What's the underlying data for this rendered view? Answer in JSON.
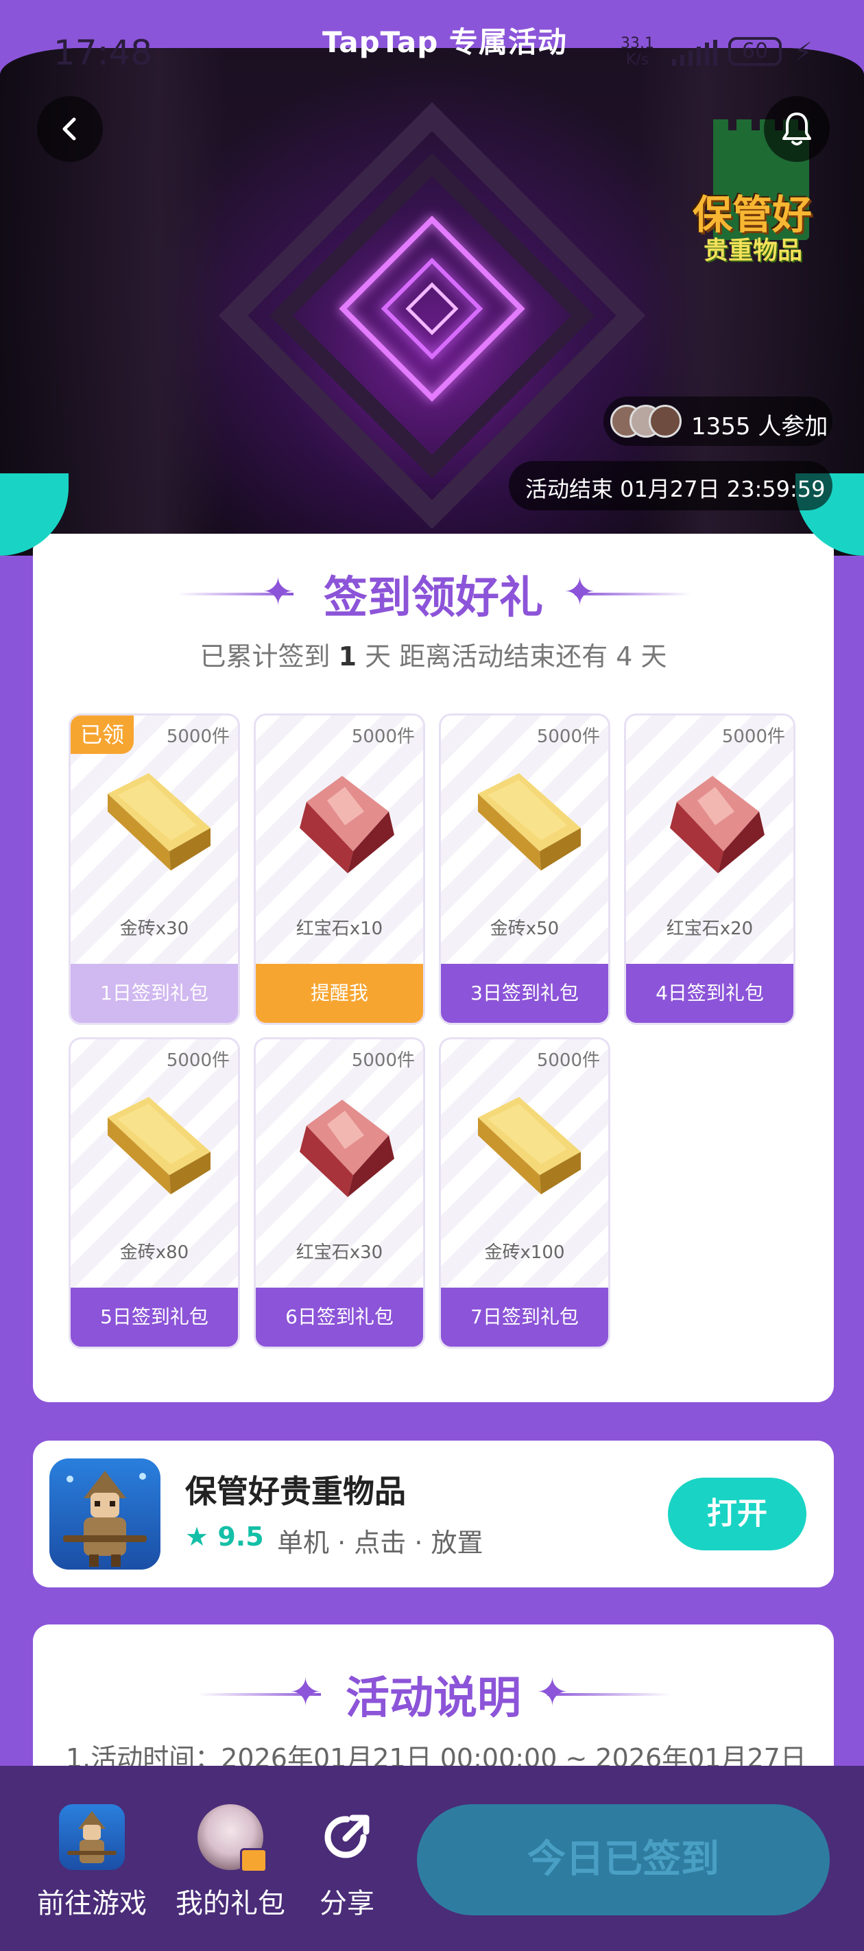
{
  "status_bar": {
    "time": "17:48",
    "net_speed_value": "33.1",
    "net_speed_unit": "K/s",
    "battery": "60"
  },
  "header": {
    "title": "TapTap 专属活动"
  },
  "hero": {
    "game_logo_main": "保管好",
    "game_logo_sub": "贵重物品",
    "participants": "1355 人参加",
    "deadline": "活动结束 01月27日 23:59:59"
  },
  "signin": {
    "title": "签到领好礼",
    "sub_prefix": "已累计签到",
    "days_signed": "1",
    "sub_mid": "天  距离活动结束还有 4 天",
    "rewards": [
      {
        "count": "5000件",
        "name": "金砖x30",
        "button": "1日签到礼包",
        "tag": "已领",
        "type": "gold",
        "state": "claimed"
      },
      {
        "count": "5000件",
        "name": "红宝石x10",
        "button": "提醒我",
        "tag": "",
        "type": "ruby",
        "state": "remind"
      },
      {
        "count": "5000件",
        "name": "金砖x50",
        "button": "3日签到礼包",
        "tag": "",
        "type": "gold",
        "state": "locked"
      },
      {
        "count": "5000件",
        "name": "红宝石x20",
        "button": "4日签到礼包",
        "tag": "",
        "type": "ruby",
        "state": "locked"
      },
      {
        "count": "5000件",
        "name": "金砖x80",
        "button": "5日签到礼包",
        "tag": "",
        "type": "gold",
        "state": "locked"
      },
      {
        "count": "5000件",
        "name": "红宝石x30",
        "button": "6日签到礼包",
        "tag": "",
        "type": "ruby",
        "state": "locked"
      },
      {
        "count": "5000件",
        "name": "金砖x100",
        "button": "7日签到礼包",
        "tag": "",
        "type": "gold",
        "state": "locked"
      }
    ]
  },
  "game": {
    "name": "保管好贵重物品",
    "rating": "9.5",
    "tags": "单机 · 点击 · 放置",
    "open_label": "打开"
  },
  "description": {
    "title": "活动说明",
    "line1": "1.活动时间：2026年01月21日 00:00:00 ~ 2026年01月27日"
  },
  "bottom_bar": {
    "go_game": "前往游戏",
    "my_gifts": "我的礼包",
    "share": "分享",
    "signed_label": "今日已签到"
  },
  "colors": {
    "accent_purple": "#8c54d8",
    "teal": "#19d4c4",
    "orange": "#f7a531",
    "bottom_bar": "#4a2c78"
  },
  "icons": [
    "back-arrow-icon",
    "bell-icon",
    "star-icon",
    "share-icon",
    "gold-bar-icon",
    "ruby-icon",
    "signal-icon",
    "battery-icon",
    "charge-icon"
  ]
}
